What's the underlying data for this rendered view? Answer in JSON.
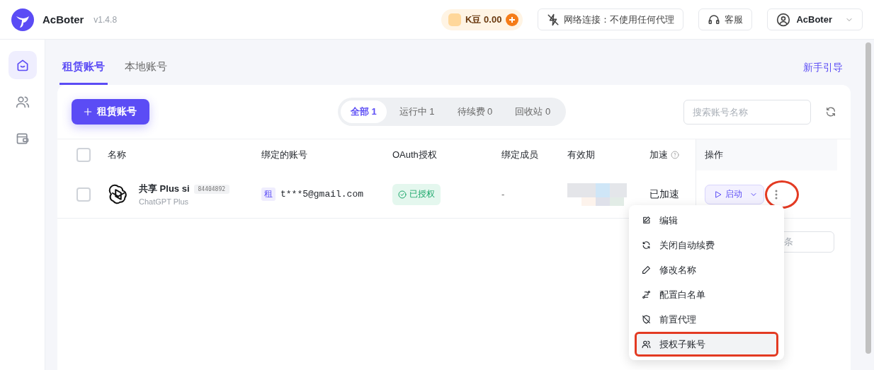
{
  "app": {
    "name": "AcBoter",
    "version": "v1.4.8"
  },
  "header": {
    "coins": "K豆 0.00",
    "network": "网络连接：不使用任何代理",
    "support": "客服",
    "user": "AcBoter"
  },
  "sidebar": {
    "items": [
      {
        "kind": "home",
        "selected": true
      },
      {
        "kind": "users",
        "selected": false
      },
      {
        "kind": "wallet",
        "selected": false
      }
    ]
  },
  "tabs": [
    {
      "label": "租赁账号",
      "selected": true
    },
    {
      "label": "本地账号",
      "selected": false
    }
  ],
  "guide_link": "新手引导",
  "add_button": "租赁账号",
  "filters": [
    {
      "label": "全部 1",
      "selected": true
    },
    {
      "label": "运行中 1",
      "selected": false
    },
    {
      "label": "待续费 0",
      "selected": false
    },
    {
      "label": "回收站 0",
      "selected": false
    }
  ],
  "search": {
    "placeholder": "搜索账号名称"
  },
  "table": {
    "header_checked": false,
    "columns": [
      {
        "label": "名称"
      },
      {
        "label": "绑定的账号"
      },
      {
        "label": "OAuth授权"
      },
      {
        "label": "绑定成员"
      },
      {
        "label": "有效期"
      },
      {
        "label": "加速",
        "help": true
      },
      {
        "label": "操作"
      }
    ],
    "rows": [
      {
        "checked": false,
        "name": "共享 Plus si",
        "id_badge": "84404892",
        "plan": "ChatGPT Plus",
        "account_tag": "租",
        "account": "t***5@gmail.com",
        "oauth": "已授权",
        "members": "-",
        "accel": "已加速",
        "action": "启动",
        "more_circled": true
      }
    ]
  },
  "pagination": {
    "page_size": "条"
  },
  "menu": {
    "items": [
      {
        "kind": "edit",
        "label": "编辑",
        "highlighted": false
      },
      {
        "kind": "refresh",
        "label": "关闭自动续费",
        "highlighted": false
      },
      {
        "kind": "pencil",
        "label": "修改名称",
        "highlighted": false
      },
      {
        "kind": "route",
        "label": "配置白名单",
        "highlighted": false
      },
      {
        "kind": "shield",
        "label": "前置代理",
        "highlighted": false
      },
      {
        "kind": "users",
        "label": "授权子账号",
        "highlighted": true
      }
    ]
  }
}
